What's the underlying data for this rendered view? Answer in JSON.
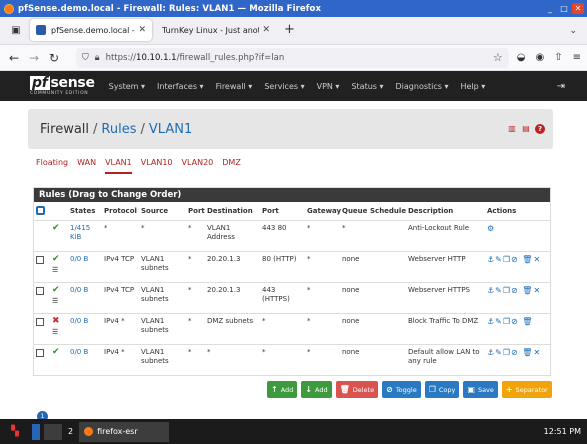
{
  "window": {
    "title": "pfSense.demo.local - Firewall: Rules: VLAN1 — Mozilla Firefox",
    "controls": [
      "_",
      "□",
      "✕"
    ]
  },
  "browser": {
    "tabs": [
      {
        "label": "pfSense.demo.local - Fire",
        "active": true,
        "close": "✕"
      },
      {
        "label": "TurnKey Linux - Just another",
        "active": false,
        "close": "✕"
      }
    ],
    "new_tab": "+",
    "url_prefix": "https://",
    "url_host": "10.10.1.1",
    "url_path": "/firewall_rules.php?if=lan"
  },
  "pfsense": {
    "logo": "sense",
    "logo_box": "pf",
    "edition": "COMMUNITY EDITION",
    "menu": [
      "System ▾",
      "Interfaces ▾",
      "Firewall ▾",
      "Services ▾",
      "VPN ▾",
      "Status ▾",
      "Diagnostics ▾",
      "Help ▾"
    ]
  },
  "breadcrumb": {
    "root": "Firewall",
    "sep1": "/",
    "mid": "Rules",
    "sep2": "/",
    "leaf": "VLAN1"
  },
  "iftabs": [
    "Floating",
    "WAN",
    "VLAN1",
    "VLAN10",
    "VLAN20",
    "DMZ"
  ],
  "rules_panel": {
    "title": "Rules (Drag to Change Order)",
    "columns": [
      "",
      "",
      "States",
      "Protocol",
      "Source",
      "Port",
      "Destination",
      "Port",
      "Gateway",
      "Queue",
      "Schedule",
      "Description",
      "Actions"
    ],
    "rows": [
      {
        "check": false,
        "action": "pass",
        "states": "1/415 KiB",
        "protocol": "*",
        "source": "*",
        "sport": "*",
        "dest": "VLAN1 Address",
        "dport": "443 80",
        "gateway": "*",
        "queue": "*",
        "schedule": "",
        "desc": "Anti-Lockout Rule",
        "actions": "⚙"
      },
      {
        "check": true,
        "action": "pass",
        "states": "0/0 B",
        "protocol": "IPv4 TCP",
        "source": "VLAN1 subnets",
        "sport": "*",
        "dest": "20.20.1.3",
        "dport": "80 (HTTP)",
        "gateway": "*",
        "queue": "none",
        "schedule": "",
        "desc": "Webserver HTTP",
        "actions": "⚓✎❐⊘ 🗑✕"
      },
      {
        "check": true,
        "action": "pass",
        "states": "0/0 B",
        "protocol": "IPv4 TCP",
        "source": "VLAN1 subnets",
        "sport": "*",
        "dest": "20.20.1.3",
        "dport": "443 (HTTPS)",
        "gateway": "*",
        "queue": "none",
        "schedule": "",
        "desc": "Webserver HTTPS",
        "actions": "⚓✎❐⊘ 🗑✕"
      },
      {
        "check": true,
        "action": "block",
        "states": "0/0 B",
        "protocol": "IPv4 *",
        "source": "VLAN1 subnets",
        "sport": "*",
        "dest": "DMZ subnets",
        "dport": "*",
        "gateway": "*",
        "queue": "none",
        "schedule": "",
        "desc": "Block Traffic To DMZ",
        "actions": "⚓✎❐⊘ 🗑"
      },
      {
        "check": true,
        "action": "pass",
        "states": "0/0 B",
        "protocol": "IPv4 *",
        "source": "VLAN1 subnets",
        "sport": "*",
        "dest": "*",
        "dport": "*",
        "gateway": "*",
        "queue": "none",
        "schedule": "",
        "desc": "Default allow LAN to any rule",
        "actions": "⚓✎❐⊘ 🗑✕"
      }
    ]
  },
  "buttons": {
    "add_top": "Add",
    "add_bottom": "Add",
    "delete": "Delete",
    "toggle": "Toggle",
    "copy": "Copy",
    "save": "Save",
    "separator": "Separator"
  },
  "taskbar": {
    "workspace": "2",
    "app": "firefox-esr",
    "clock": "12:51 PM",
    "badge": "1"
  },
  "colors": {
    "titlebar": "#2f66c7",
    "pf_header": "#212121",
    "accent_link": "#1e6cb3",
    "tab_red": "#b2221f",
    "pass": "#2e8b2e",
    "block": "#c9302c"
  }
}
